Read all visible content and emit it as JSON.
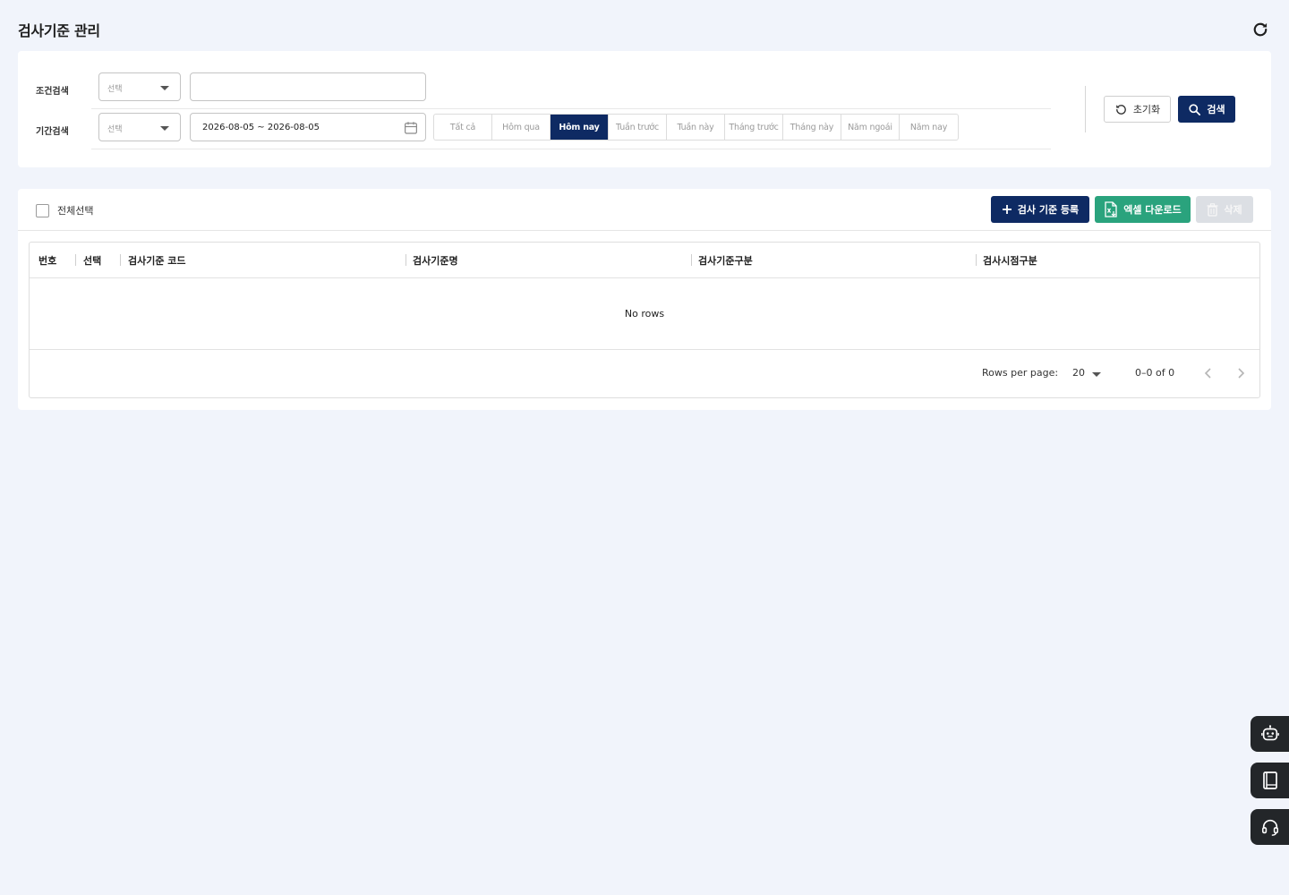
{
  "page": {
    "title": "검사기준 관리",
    "refresh_icon": "refresh-icon"
  },
  "search": {
    "condition_label": "조건검색",
    "condition_select_placeholder": "선택",
    "condition_text_value": "",
    "period_label": "기간검색",
    "period_select_placeholder": "선택",
    "date_range": "2026-08-05 ~ 2026-08-05",
    "period_buttons": [
      "Tất cả",
      "Hôm qua",
      "Hôm nay",
      "Tuần trước",
      "Tuần này",
      "Tháng trước",
      "Tháng này",
      "Năm ngoái",
      "Năm nay"
    ],
    "active_period": "Hôm nay",
    "reset_label": "초기화",
    "search_label": "검색"
  },
  "toolbar": {
    "select_all_label": "전체선택",
    "add_label": "검사 기준 등록",
    "excel_label": "엑셀 다운로드",
    "delete_label": "삭제"
  },
  "grid": {
    "columns": [
      "번호",
      "선택",
      "검사기준 코드",
      "검사기준명",
      "검사기준구분",
      "검사시점구분"
    ],
    "empty_text": "No rows",
    "rows": []
  },
  "pagination": {
    "rows_per_page_label": "Rows per page:",
    "rows_per_page": "20",
    "range_text": "0–0 of 0"
  },
  "floating_buttons": [
    "robot-icon",
    "book-icon",
    "headset-icon"
  ],
  "colors": {
    "primary": "#0e2a63",
    "excel": "#2aa37d",
    "background": "#f1f4fb",
    "disabled": "#dcdfe4"
  }
}
